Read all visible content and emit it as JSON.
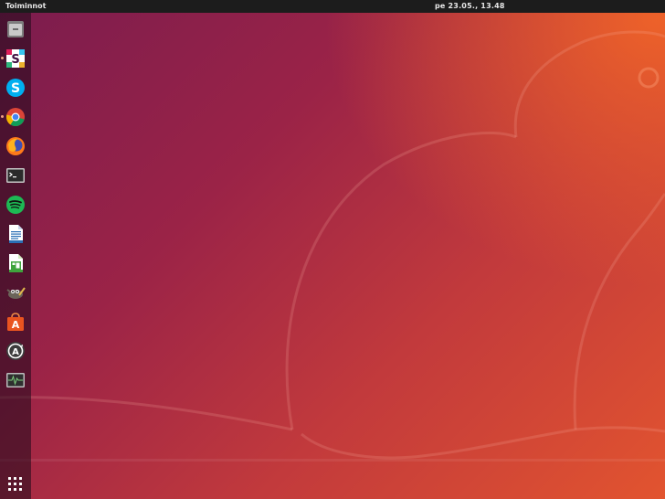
{
  "topbar": {
    "activities_label": "Toiminnot",
    "clock": "pe 23.05., 13.48"
  },
  "dock": {
    "items": [
      {
        "name": "files",
        "icon": "files-icon",
        "running": false
      },
      {
        "name": "slack",
        "icon": "slack-icon",
        "running": true
      },
      {
        "name": "skype",
        "icon": "skype-icon",
        "running": false
      },
      {
        "name": "chrome",
        "icon": "chrome-icon",
        "running": true
      },
      {
        "name": "firefox",
        "icon": "firefox-icon",
        "running": false
      },
      {
        "name": "terminal",
        "icon": "terminal-icon",
        "running": false
      },
      {
        "name": "spotify",
        "icon": "spotify-icon",
        "running": false
      },
      {
        "name": "libreoffice-writer",
        "icon": "writer-icon",
        "running": false
      },
      {
        "name": "libreoffice-calc",
        "icon": "calc-icon",
        "running": false
      },
      {
        "name": "gimp",
        "icon": "gimp-icon",
        "running": false
      },
      {
        "name": "ubuntu-software",
        "icon": "software-icon",
        "running": false
      },
      {
        "name": "software-updater",
        "icon": "updater-icon",
        "running": false
      },
      {
        "name": "system-monitor",
        "icon": "system-monitor-icon",
        "running": false
      }
    ],
    "show_apps_icon": "app-grid-icon"
  },
  "colors": {
    "topbar": "#1c1c1c",
    "wallpaper_start": "#7a1c4e",
    "wallpaper_end": "#e2542f"
  }
}
